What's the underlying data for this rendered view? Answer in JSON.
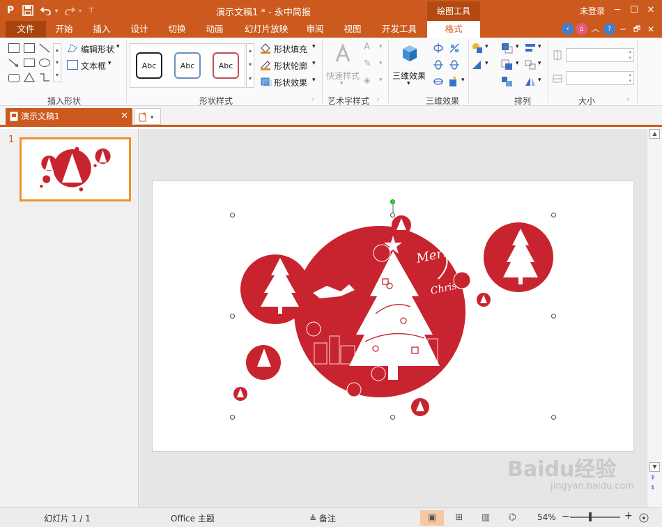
{
  "titlebar": {
    "app_logo": "P",
    "document_title": "演示文稿1 * - 永中简报",
    "tool_tab": "绘图工具",
    "login": "未登录",
    "minimize_glyph": "─",
    "maximize_glyph": "☐",
    "close_glyph": "✕",
    "restore_glyph": "🗗",
    "close2_glyph": "✕"
  },
  "tabs": [
    "文件",
    "开始",
    "插入",
    "设计",
    "切换",
    "动画",
    "幻灯片放映",
    "审阅",
    "视图",
    "开发工具",
    "格式"
  ],
  "ribbon": {
    "edit_shape": "编辑形状",
    "text_box": "文本框",
    "insert_shapes_label": "插入形状",
    "style_abc": [
      "Abc",
      "Abc",
      "Abc"
    ],
    "shape_fill": "形状填充",
    "shape_outline": "形状轮廓",
    "shape_effect": "形状效果",
    "shape_style_label": "形状样式",
    "quick_style": "快速样式",
    "art_style_label": "艺术字样式",
    "three_d_effect": "三维效果",
    "three_d_label": "三维效果",
    "arrange_label": "排列",
    "size_label": "大小"
  },
  "docbar": {
    "tab_name": "演示文稿1"
  },
  "thumbs": {
    "number": "1"
  },
  "slide": {
    "merry_text": "Merry",
    "christmas_text": "Christmas"
  },
  "status": {
    "slide_info": "幻灯片 1 / 1",
    "theme": "Office 主题",
    "notes": "备注",
    "zoom": "54%"
  },
  "watermark": {
    "brand": "Baidu经验",
    "url": "jingyan.baidu.com"
  },
  "colors": {
    "accent": "#cc5a1e",
    "christmas_red": "#c8242f"
  }
}
